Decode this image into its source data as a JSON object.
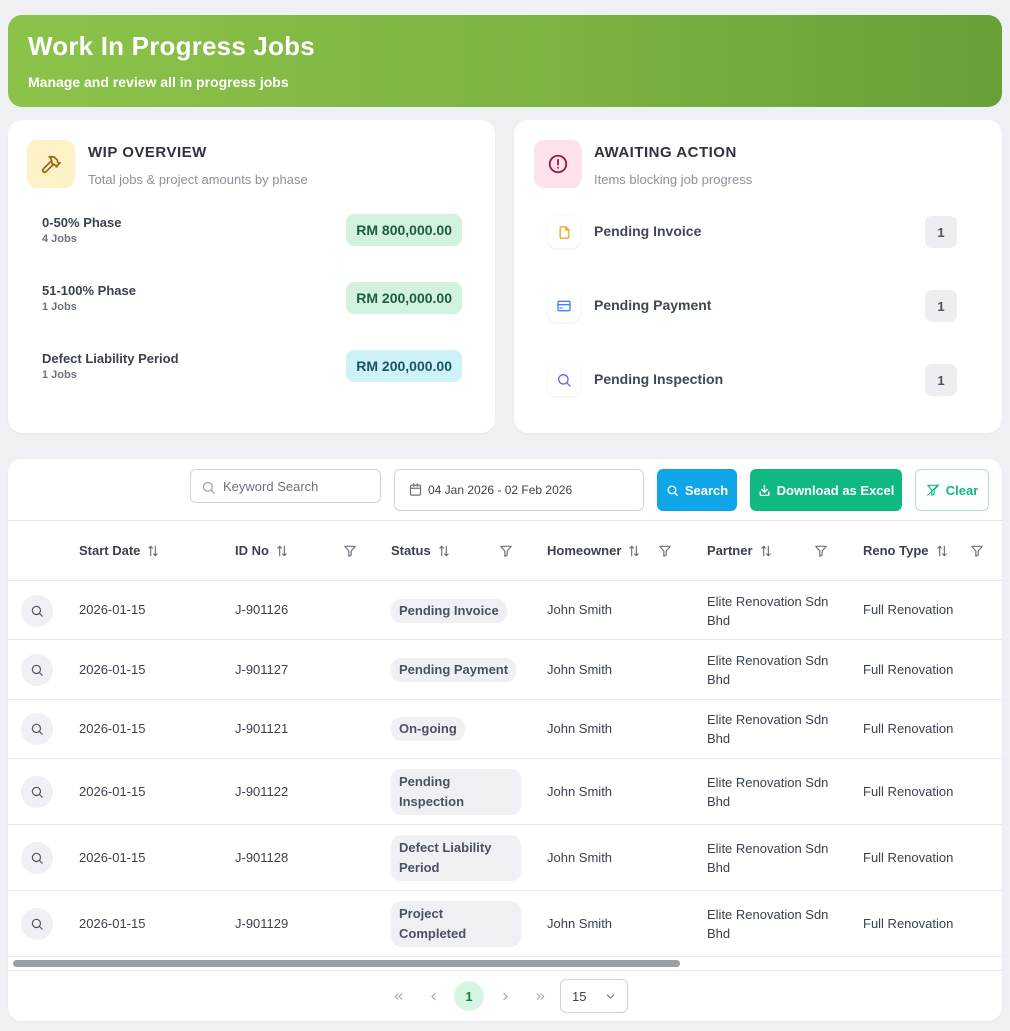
{
  "header": {
    "title": "Work In Progress Jobs",
    "subtitle": "Manage and review all in progress jobs",
    "gradient_colors": [
      "#8bc34a",
      "#689f38"
    ]
  },
  "wip": {
    "title": "WIP OVERVIEW",
    "subtitle": "Total jobs & project amounts by phase",
    "icon": "hammer-icon",
    "phases": [
      {
        "name": "0-50% Phase",
        "jobs": "4 Jobs",
        "amount": "RM 800,000.00"
      },
      {
        "name": "51-100% Phase",
        "jobs": "1 Jobs",
        "amount": "RM 200,000.00"
      },
      {
        "name": "Defect Liability Period",
        "jobs": "1 Jobs",
        "amount": "RM 200,000.00"
      }
    ]
  },
  "awaiting": {
    "title": "AWAITING ACTION",
    "subtitle": "Items blocking job progress",
    "icon": "alert-circle-icon",
    "items": [
      {
        "label": "Pending Invoice",
        "count": "1",
        "icon": "file-icon"
      },
      {
        "label": "Pending Payment",
        "count": "1",
        "icon": "credit-card-icon"
      },
      {
        "label": "Pending Inspection",
        "count": "1",
        "icon": "search-icon"
      }
    ]
  },
  "toolbar": {
    "search_placeholder": "Keyword Search",
    "date_range": "04 Jan 2026 - 02 Feb 2026",
    "search_label": "Search",
    "excel_label": "Download as Excel",
    "clear_label": "Clear"
  },
  "table": {
    "columns": [
      "Start Date",
      "ID No",
      "Status",
      "Homeowner",
      "Partner",
      "Reno Type"
    ],
    "rows": [
      {
        "start": "2026-01-15",
        "id": "J-901126",
        "status": "Pending Invoice",
        "homeowner": "John Smith",
        "partner": "Elite Renovation Sdn Bhd",
        "reno": "Full Renovation"
      },
      {
        "start": "2026-01-15",
        "id": "J-901127",
        "status": "Pending Payment",
        "homeowner": "John Smith",
        "partner": "Elite Renovation Sdn Bhd",
        "reno": "Full Renovation"
      },
      {
        "start": "2026-01-15",
        "id": "J-901121",
        "status": "On-going",
        "homeowner": "John Smith",
        "partner": "Elite Renovation Sdn Bhd",
        "reno": "Full Renovation"
      },
      {
        "start": "2026-01-15",
        "id": "J-901122",
        "status": "Pending Inspection",
        "homeowner": "John Smith",
        "partner": "Elite Renovation Sdn Bhd",
        "reno": "Full Renovation"
      },
      {
        "start": "2026-01-15",
        "id": "J-901128",
        "status": "Defect Liability Period",
        "homeowner": "John Smith",
        "partner": "Elite Renovation Sdn Bhd",
        "reno": "Full Renovation"
      },
      {
        "start": "2026-01-15",
        "id": "J-901129",
        "status": "Project Completed",
        "homeowner": "John Smith",
        "partner": "Elite Renovation Sdn Bhd",
        "reno": "Full Renovation"
      }
    ]
  },
  "pagination": {
    "current_page": "1",
    "per_page": "15"
  }
}
